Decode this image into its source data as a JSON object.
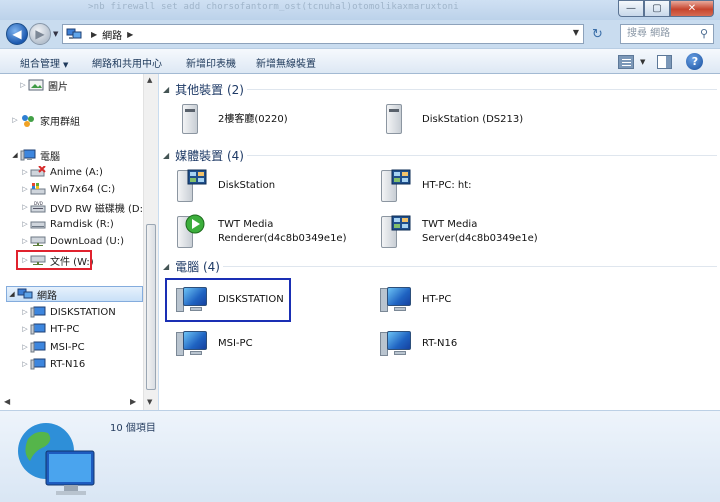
{
  "window": {
    "ghost_command": ">nb firewall set add chorsofantorm_ost(tcnuhal)otomolikaxmaruxtoni",
    "buttons": {
      "minimize": "—",
      "maximize": "▢",
      "close": "✕"
    }
  },
  "address": {
    "path": [
      "網路"
    ],
    "search_placeholder": "搜尋 網路",
    "refresh": "↻"
  },
  "toolbar": {
    "organize": "組合管理",
    "network_center": "網路和共用中心",
    "add_printer": "新增印表機",
    "add_wireless": "新增無線裝置",
    "help": "?"
  },
  "nav": {
    "pictures": "圖片",
    "homegroup": "家用群組",
    "computer": "電腦",
    "drives": [
      "Anime (A:)",
      "Win7x64 (C:)",
      "DVD RW 磁碟機 (D:) G",
      "Ramdisk (R:)",
      "DownLoad (U:)",
      "文件 (W:)"
    ],
    "network": "網路",
    "network_items": [
      "DISKSTATION",
      "HT-PC",
      "MSI-PC",
      "RT-N16"
    ]
  },
  "groups": {
    "other_devices": {
      "title": "其他裝置 (2)",
      "items": [
        "2樓客廳(0220)",
        "DiskStation (DS213)"
      ]
    },
    "media_devices": {
      "title": "媒體裝置 (4)",
      "items": [
        {
          "line1": "DiskStation",
          "line2": ""
        },
        {
          "line1": "HT-PC: ht:",
          "line2": ""
        },
        {
          "line1": "TWT Media",
          "line2": "Renderer(d4c8b0349e1e)"
        },
        {
          "line1": "TWT Media",
          "line2": "Server(d4c8b0349e1e)"
        }
      ]
    },
    "computers": {
      "title": "電腦 (4)",
      "items": [
        "DISKSTATION",
        "HT-PC",
        "MSI-PC",
        "RT-N16"
      ]
    }
  },
  "details": {
    "count": "10 個項目"
  },
  "colors": {
    "highlight_red": "#e0222e",
    "highlight_blue": "#1a2fb4",
    "selection": "#c9e0f7"
  }
}
